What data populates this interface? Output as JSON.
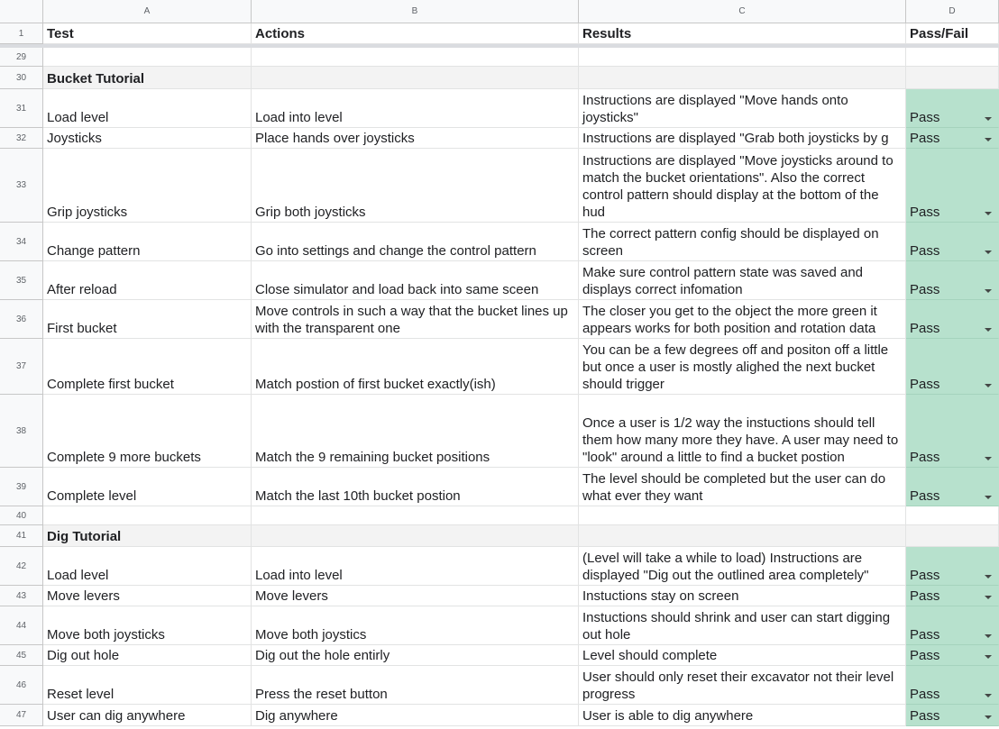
{
  "columns": [
    "A",
    "B",
    "C",
    "D"
  ],
  "header": {
    "row": "1",
    "test": "Test",
    "actions": "Actions",
    "results": "Results",
    "pass_fail": "Pass/Fail"
  },
  "rows": [
    {
      "n": "29",
      "kind": "blank"
    },
    {
      "n": "30",
      "kind": "section",
      "title": "Bucket Tutorial"
    },
    {
      "n": "31",
      "test": "Load level",
      "actions": "Load into level",
      "results": "Instructions are displayed \"Move hands onto joysticks\"",
      "status": "Pass"
    },
    {
      "n": "32",
      "test": "Joysticks",
      "actions": "Place hands over joysticks",
      "results": "Instructions are displayed \"Grab both joysticks by g",
      "status": "Pass"
    },
    {
      "n": "33",
      "test": "Grip joysticks",
      "actions": "Grip both joysticks",
      "results": "Instructions are displayed \"Move joysticks around to match the bucket orientations\". Also the correct control pattern should display at the bottom of the hud",
      "status": "Pass"
    },
    {
      "n": "34",
      "test": "Change pattern",
      "actions": "Go into settings and change the control pattern",
      "results": "The correct pattern config should be displayed on screen",
      "status": "Pass"
    },
    {
      "n": "35",
      "test": "After reload",
      "actions": "Close simulator and load back into same sceen",
      "results": "Make sure control pattern state was saved and displays correct infomation",
      "status": "Pass"
    },
    {
      "n": "36",
      "test": "First bucket",
      "actions": "Move controls in such a way that the bucket lines up with the transparent one",
      "results": "The closer you get to the object the more green it appears works for both position and rotation data",
      "status": "Pass"
    },
    {
      "n": "37",
      "test": "Complete first bucket",
      "actions": "Match postion of first bucket exactly(ish)",
      "results": "You can be a few degrees off and positon off a little but once a user is mostly alighed the next bucket should trigger",
      "status": "Pass"
    },
    {
      "n": "38",
      "test": "Complete 9 more buckets",
      "actions": "Match the 9 remaining bucket positions",
      "results": "Once a user is 1/2 way the instuctions should tell them how many more they have. A user may need to \"look\" around a little to find a bucket postion",
      "status": "Pass"
    },
    {
      "n": "39",
      "test": "Complete level",
      "actions": "Match the last 10th bucket postion",
      "results": "The level should be completed but the user can do what ever they want",
      "status": "Pass"
    },
    {
      "n": "40",
      "kind": "blank"
    },
    {
      "n": "41",
      "kind": "section",
      "title": "Dig Tutorial"
    },
    {
      "n": "42",
      "test": "Load level",
      "actions": "Load into level",
      "results": "(Level will take a while to load) Instructions are displayed \"Dig out the outlined area completely\"",
      "status": "Pass"
    },
    {
      "n": "43",
      "test": "Move levers",
      "actions": "Move levers",
      "results": "Instuctions stay on screen",
      "status": "Pass"
    },
    {
      "n": "44",
      "test": "Move both joysticks",
      "actions": "Move both joystics",
      "results": "Instuctions should shrink and user can start digging out hole",
      "status": "Pass"
    },
    {
      "n": "45",
      "test": "Dig out hole",
      "actions": "Dig out the hole entirly",
      "results": "Level should complete",
      "status": "Pass"
    },
    {
      "n": "46",
      "test": "Reset level",
      "actions": "Press the reset button",
      "results": "User should only reset their excavator not their level progress",
      "status": "Pass"
    },
    {
      "n": "47",
      "test": "User can dig anywhere",
      "actions": "Dig anywhere",
      "results": "User is able to dig anywhere",
      "status": "Pass"
    }
  ],
  "colors": {
    "pass_fill": "#b7e1cd",
    "section_fill": "#f3f3f3",
    "header_fill": "#f8f9fa"
  }
}
